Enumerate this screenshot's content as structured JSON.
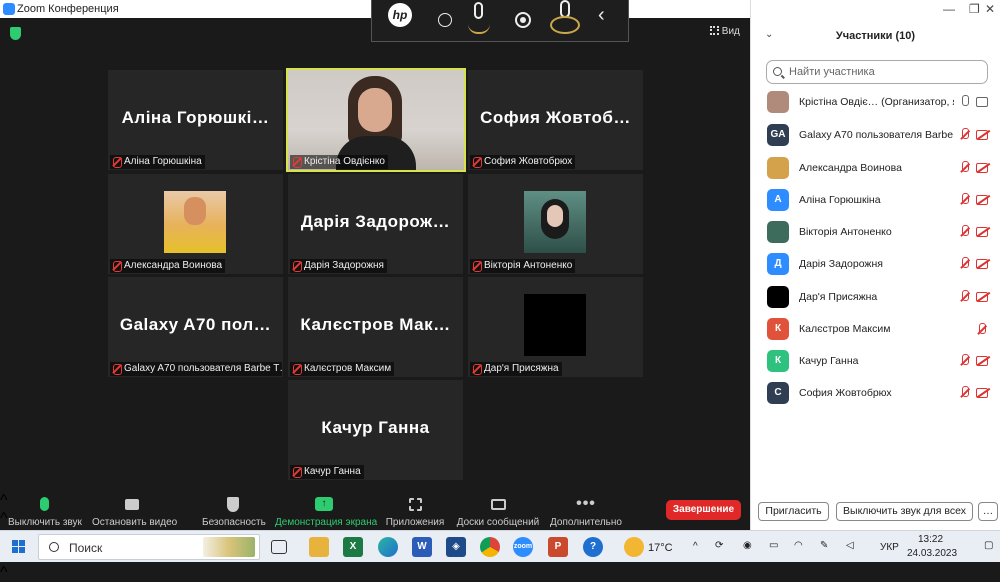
{
  "window": {
    "title": "Zoom Конференция"
  },
  "view_label": "Вид",
  "tiles": [
    {
      "big": "Аліна Горюшкі…",
      "name": "Аліна Горюшкіна",
      "type": "text"
    },
    {
      "big": "",
      "name": "Крістіна Овдієнко",
      "type": "video",
      "active": true
    },
    {
      "big": "София Жовтоб…",
      "name": "София Жовтобрюх",
      "type": "text"
    },
    {
      "big": "",
      "name": "Александра Воинова",
      "type": "photo"
    },
    {
      "big": "Дарія Задорож…",
      "name": "Дарія Задорожня",
      "type": "text"
    },
    {
      "big": "",
      "name": "Вікторія Антоненко",
      "type": "photo"
    },
    {
      "big": "Galaxy A70 пол…",
      "name": "Galaxy A70 пользователя Barbe T…",
      "type": "text"
    },
    {
      "big": "Калєстров Мак…",
      "name": "Калєстров Максим",
      "type": "text"
    },
    {
      "big": "",
      "name": "Дар'я Присяжна",
      "type": "black"
    },
    {
      "big": "Качур Ганна",
      "name": "Качур Ганна",
      "type": "text"
    }
  ],
  "toolbar": {
    "mute": "Выключить звук",
    "video": "Остановить видео",
    "security": "Безопасность",
    "share": "Демонстрация экрана",
    "apps": "Приложения",
    "whiteboard": "Доски сообщений",
    "more": "Дополнительно",
    "end": "Завершение"
  },
  "panel": {
    "title": "Участники (10)",
    "search_placeholder": "Найти участника",
    "invite": "Пригласить",
    "mute_all": "Выключить звук для всех",
    "more": "…",
    "participants": [
      {
        "name": "Крістіна Овдіє… (Организатор, я)",
        "initials": "",
        "color": "#b08a7a",
        "mic": "on",
        "cam": "on"
      },
      {
        "name": "Galaxy A70 пользователя Barbe…",
        "initials": "GA",
        "color": "#2f3e52",
        "mic": "off",
        "cam": "off"
      },
      {
        "name": "Александра Воинова",
        "initials": "",
        "color": "#d4a24a",
        "mic": "off",
        "cam": "off"
      },
      {
        "name": "Аліна Горюшкіна",
        "initials": "А",
        "color": "#2d8cff",
        "mic": "off",
        "cam": "off"
      },
      {
        "name": "Вікторія Антоненко",
        "initials": "",
        "color": "#3d6b5c",
        "mic": "off",
        "cam": "off"
      },
      {
        "name": "Дарія Задорожня",
        "initials": "Д",
        "color": "#2d8cff",
        "mic": "off",
        "cam": "off"
      },
      {
        "name": "Дар'я Присяжна",
        "initials": "",
        "color": "#000000",
        "mic": "off",
        "cam": "off"
      },
      {
        "name": "Калєстров Максим",
        "initials": "К",
        "color": "#e0533a",
        "mic": "off",
        "cam": "none"
      },
      {
        "name": "Качур Ганна",
        "initials": "К",
        "color": "#2ec27e",
        "mic": "off",
        "cam": "off"
      },
      {
        "name": "София Жовтобрюх",
        "initials": "С",
        "color": "#2f3e52",
        "mic": "off",
        "cam": "off"
      }
    ]
  },
  "taskbar": {
    "search": "Поиск",
    "weather": "17°C",
    "lang": "УКР",
    "time": "13:22",
    "date": "24.03.2023"
  }
}
